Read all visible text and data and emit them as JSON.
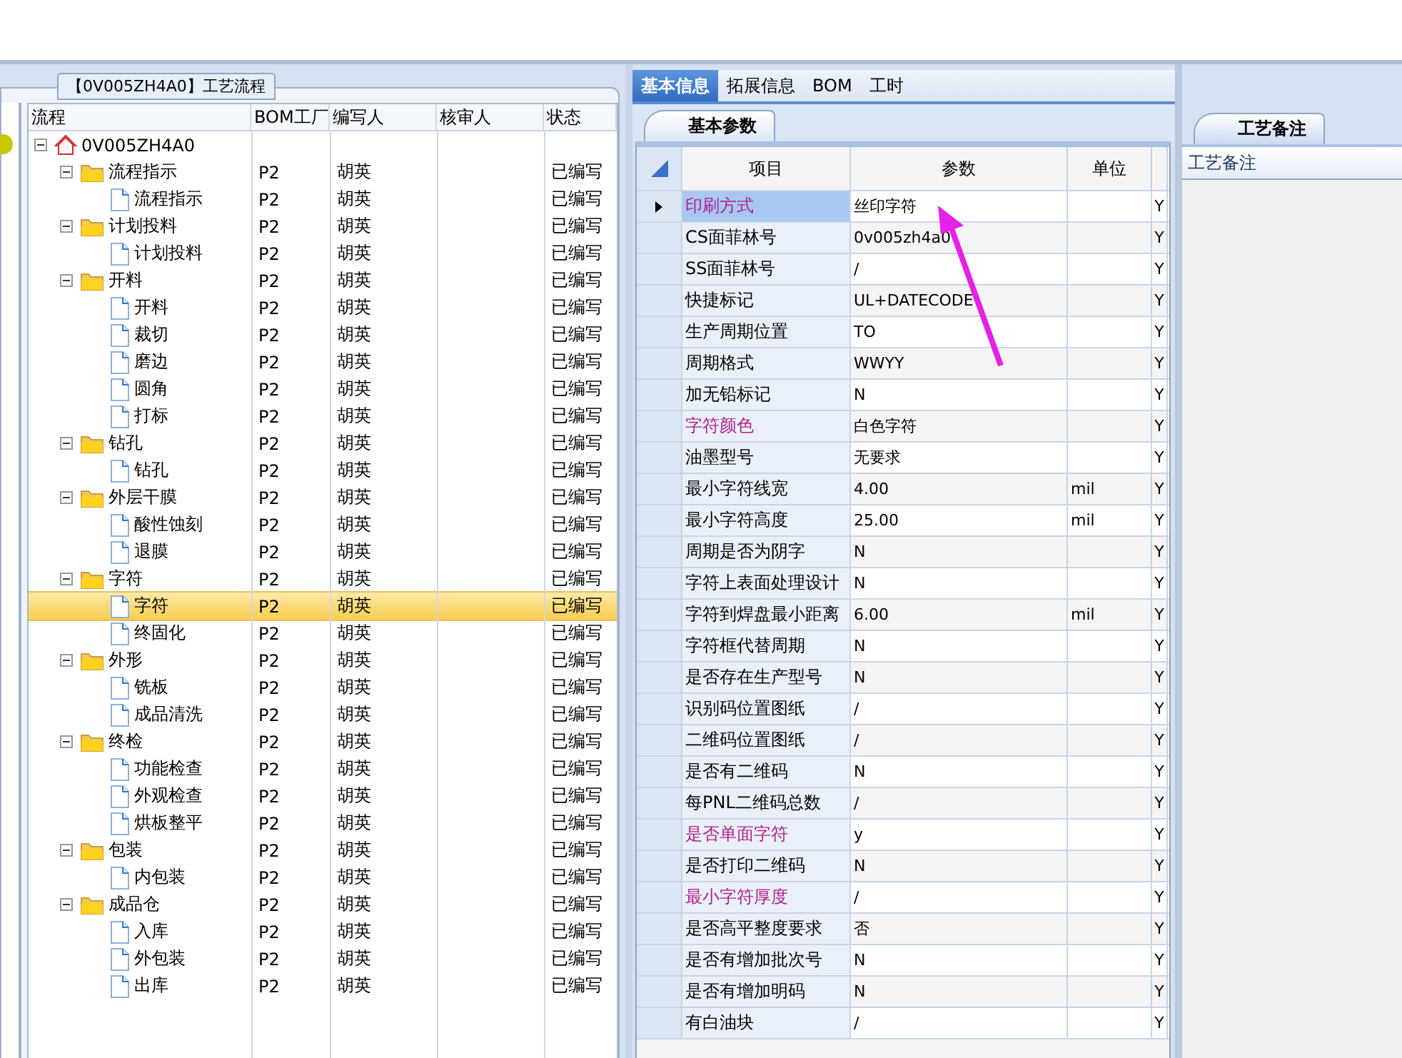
{
  "flow_panel": {
    "title": "【0V005ZH4A0】工艺流程",
    "columns": [
      "流程",
      "BOM工厂",
      "编写人",
      "核审人",
      "状态"
    ],
    "tree": [
      {
        "kind": "root",
        "name": "0V005ZH4A0",
        "expanded": true,
        "selected": false,
        "children": [
          {
            "kind": "folder",
            "name": "流程指示",
            "factory": "P2",
            "writer": "胡英",
            "status": "已编写",
            "expanded": true,
            "selected": false,
            "children": [
              {
                "kind": "file",
                "name": "流程指示",
                "factory": "P2",
                "writer": "胡英",
                "status": "已编写",
                "selected": false
              }
            ]
          },
          {
            "kind": "folder",
            "name": "计划投料",
            "factory": "P2",
            "writer": "胡英",
            "status": "已编写",
            "expanded": true,
            "selected": false,
            "children": [
              {
                "kind": "file",
                "name": "计划投料",
                "factory": "P2",
                "writer": "胡英",
                "status": "已编写",
                "selected": false
              }
            ]
          },
          {
            "kind": "folder",
            "name": "开料",
            "factory": "P2",
            "writer": "胡英",
            "status": "已编写",
            "expanded": true,
            "selected": false,
            "children": [
              {
                "kind": "file",
                "name": "开料",
                "factory": "P2",
                "writer": "胡英",
                "status": "已编写",
                "selected": false
              },
              {
                "kind": "file",
                "name": "裁切",
                "factory": "P2",
                "writer": "胡英",
                "status": "已编写",
                "selected": false
              },
              {
                "kind": "file",
                "name": "磨边",
                "factory": "P2",
                "writer": "胡英",
                "status": "已编写",
                "selected": false
              },
              {
                "kind": "file",
                "name": "圆角",
                "factory": "P2",
                "writer": "胡英",
                "status": "已编写",
                "selected": false
              },
              {
                "kind": "file",
                "name": "打标",
                "factory": "P2",
                "writer": "胡英",
                "status": "已编写",
                "selected": false
              }
            ]
          },
          {
            "kind": "folder",
            "name": "钻孔",
            "factory": "P2",
            "writer": "胡英",
            "status": "已编写",
            "expanded": true,
            "selected": false,
            "children": [
              {
                "kind": "file",
                "name": "钻孔",
                "factory": "P2",
                "writer": "胡英",
                "status": "已编写",
                "selected": false
              }
            ]
          },
          {
            "kind": "folder",
            "name": "外层干膜",
            "factory": "P2",
            "writer": "胡英",
            "status": "已编写",
            "expanded": true,
            "selected": false,
            "children": [
              {
                "kind": "file",
                "name": "酸性蚀刻",
                "factory": "P2",
                "writer": "胡英",
                "status": "已编写",
                "selected": false
              },
              {
                "kind": "file",
                "name": "退膜",
                "factory": "P2",
                "writer": "胡英",
                "status": "已编写",
                "selected": false
              }
            ]
          },
          {
            "kind": "folder",
            "name": "字符",
            "factory": "P2",
            "writer": "胡英",
            "status": "已编写",
            "expanded": true,
            "selected": false,
            "children": [
              {
                "kind": "file",
                "name": "字符",
                "factory": "P2",
                "writer": "胡英",
                "status": "已编写",
                "selected": true
              },
              {
                "kind": "file",
                "name": "终固化",
                "factory": "P2",
                "writer": "胡英",
                "status": "已编写",
                "selected": false
              }
            ]
          },
          {
            "kind": "folder",
            "name": "外形",
            "factory": "P2",
            "writer": "胡英",
            "status": "已编写",
            "expanded": true,
            "selected": false,
            "children": [
              {
                "kind": "file",
                "name": "铣板",
                "factory": "P2",
                "writer": "胡英",
                "status": "已编写",
                "selected": false
              },
              {
                "kind": "file",
                "name": "成品清洗",
                "factory": "P2",
                "writer": "胡英",
                "status": "已编写",
                "selected": false
              }
            ]
          },
          {
            "kind": "folder",
            "name": "终检",
            "factory": "P2",
            "writer": "胡英",
            "status": "已编写",
            "expanded": true,
            "selected": false,
            "children": [
              {
                "kind": "file",
                "name": "功能检查",
                "factory": "P2",
                "writer": "胡英",
                "status": "已编写",
                "selected": false
              },
              {
                "kind": "file",
                "name": "外观检查",
                "factory": "P2",
                "writer": "胡英",
                "status": "已编写",
                "selected": false
              },
              {
                "kind": "file",
                "name": "烘板整平",
                "factory": "P2",
                "writer": "胡英",
                "status": "已编写",
                "selected": false
              }
            ]
          },
          {
            "kind": "folder",
            "name": "包装",
            "factory": "P2",
            "writer": "胡英",
            "status": "已编写",
            "expanded": true,
            "selected": false,
            "children": [
              {
                "kind": "file",
                "name": "内包装",
                "factory": "P2",
                "writer": "胡英",
                "status": "已编写",
                "selected": false
              }
            ]
          },
          {
            "kind": "folder",
            "name": "成品仓",
            "factory": "P2",
            "writer": "胡英",
            "status": "已编写",
            "expanded": true,
            "selected": false,
            "children": [
              {
                "kind": "file",
                "name": "入库",
                "factory": "P2",
                "writer": "胡英",
                "status": "已编写",
                "selected": false
              },
              {
                "kind": "file",
                "name": "外包装",
                "factory": "P2",
                "writer": "胡英",
                "status": "已编写",
                "selected": false
              },
              {
                "kind": "file",
                "name": "出库",
                "factory": "P2",
                "writer": "胡英",
                "status": "已编写",
                "selected": false
              }
            ]
          }
        ]
      }
    ]
  },
  "info_panel": {
    "tabs": [
      {
        "label": "基本信息",
        "selected": true
      },
      {
        "label": "拓展信息",
        "selected": false
      },
      {
        "label": "BOM",
        "selected": false
      },
      {
        "label": "工时",
        "selected": false
      }
    ],
    "subtab": "基本参数",
    "columns": [
      "项目",
      "参数",
      "单位"
    ],
    "rows": [
      {
        "item": "印刷方式",
        "value": "丝印字符",
        "flag": "Y",
        "highlighted": true,
        "selected": true
      },
      {
        "item": "CS面菲林号",
        "value": "0v005zh4a0",
        "flag": "Y",
        "highlighted": false,
        "selected": false
      },
      {
        "item": "SS面菲林号",
        "value": "/",
        "flag": "Y",
        "highlighted": false,
        "selected": false
      },
      {
        "item": "快捷标记",
        "value": "UL+DATECODE",
        "flag": "Y",
        "highlighted": false,
        "selected": false
      },
      {
        "item": "生产周期位置",
        "value": "TO",
        "flag": "Y",
        "highlighted": false,
        "selected": false
      },
      {
        "item": "周期格式",
        "value": "WWYY",
        "flag": "Y",
        "highlighted": false,
        "selected": false
      },
      {
        "item": "加无铅标记",
        "value": "N",
        "flag": "Y",
        "highlighted": false,
        "selected": false
      },
      {
        "item": "字符颜色",
        "value": "白色字符",
        "flag": "Y",
        "highlighted": true,
        "selected": false
      },
      {
        "item": "油墨型号",
        "value": "无要求",
        "flag": "Y",
        "highlighted": false,
        "selected": false
      },
      {
        "item": "最小字符线宽",
        "value": "4.00",
        "unit": "mil",
        "flag": "Y",
        "highlighted": false,
        "selected": false
      },
      {
        "item": "最小字符高度",
        "value": "25.00",
        "unit": "mil",
        "flag": "Y",
        "highlighted": false,
        "selected": false
      },
      {
        "item": "周期是否为阴字",
        "value": "N",
        "flag": "Y",
        "highlighted": false,
        "selected": false
      },
      {
        "item": "字符上表面处理设计",
        "value": "N",
        "flag": "Y",
        "highlighted": false,
        "selected": false
      },
      {
        "item": "字符到焊盘最小距离",
        "value": "6.00",
        "unit": "mil",
        "flag": "Y",
        "highlighted": false,
        "selected": false
      },
      {
        "item": "字符框代替周期",
        "value": "N",
        "flag": "Y",
        "highlighted": false,
        "selected": false
      },
      {
        "item": "是否存在生产型号",
        "value": "N",
        "flag": "Y",
        "highlighted": false,
        "selected": false
      },
      {
        "item": "识别码位置图纸",
        "value": "/",
        "flag": "Y",
        "highlighted": false,
        "selected": false
      },
      {
        "item": "二维码位置图纸",
        "value": "/",
        "flag": "Y",
        "highlighted": false,
        "selected": false
      },
      {
        "item": "是否有二维码",
        "value": "N",
        "flag": "Y",
        "highlighted": false,
        "selected": false
      },
      {
        "item": "每PNL二维码总数",
        "value": "/",
        "flag": "Y",
        "highlighted": false,
        "selected": false
      },
      {
        "item": "是否单面字符",
        "value": "y",
        "flag": "Y",
        "highlighted": true,
        "selected": false
      },
      {
        "item": "是否打印二维码",
        "value": "N",
        "flag": "Y",
        "highlighted": false,
        "selected": false
      },
      {
        "item": "最小字符厚度",
        "value": "/",
        "flag": "Y",
        "highlighted": true,
        "selected": false
      },
      {
        "item": "是否高平整度要求",
        "value": "否",
        "flag": "Y",
        "highlighted": false,
        "selected": false
      },
      {
        "item": "是否有增加批次号",
        "value": "N",
        "flag": "Y",
        "highlighted": false,
        "selected": false
      },
      {
        "item": "是否有增加明码",
        "value": "N",
        "flag": "Y",
        "highlighted": false,
        "selected": false
      },
      {
        "item": "有白油块",
        "value": "/",
        "flag": "Y",
        "highlighted": false,
        "selected": false
      }
    ]
  },
  "notes_panel": {
    "tab": "工艺备注",
    "header": "工艺备注"
  }
}
